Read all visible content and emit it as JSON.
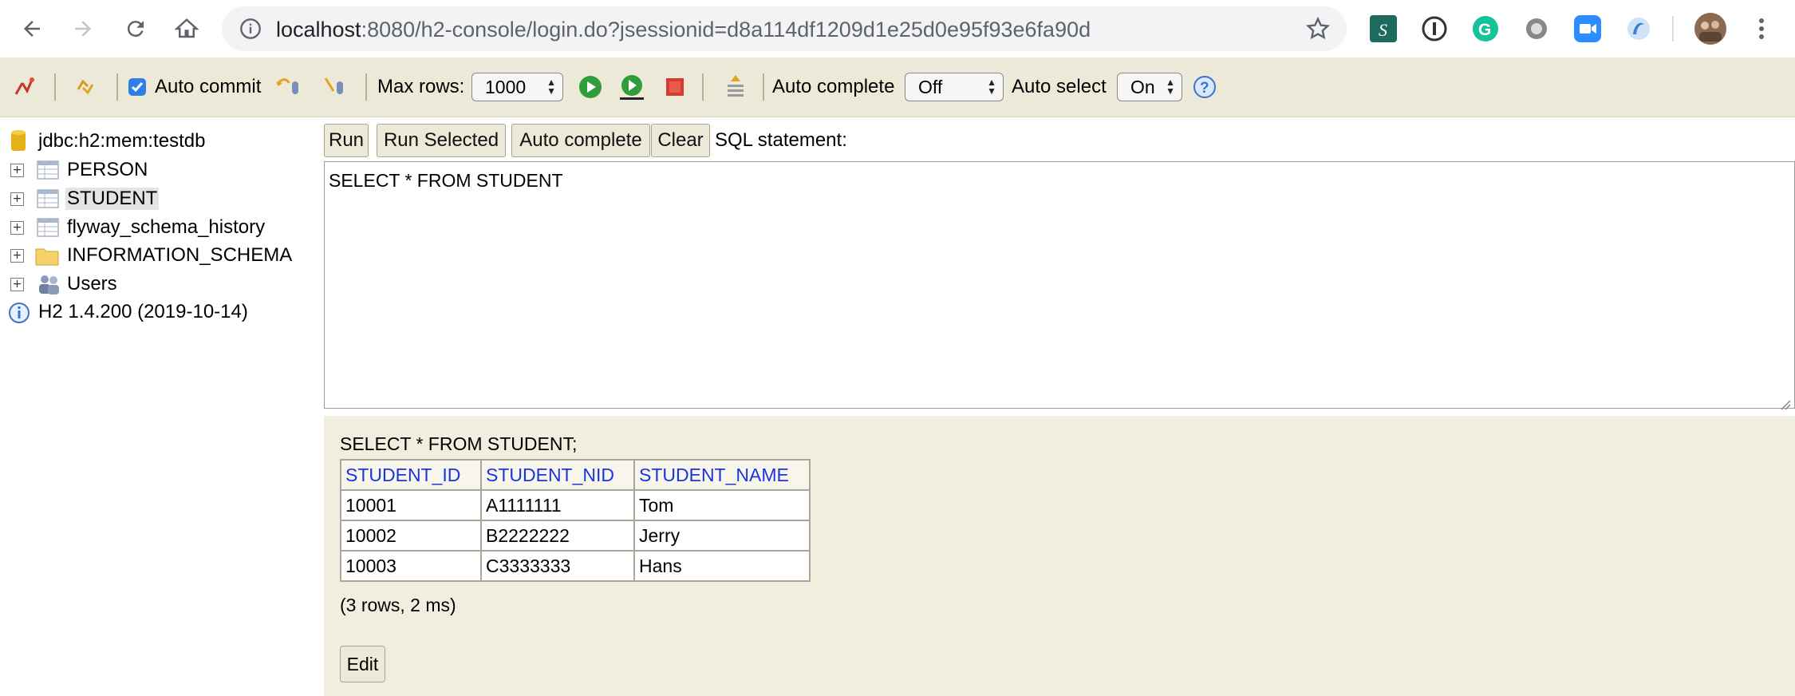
{
  "browser": {
    "url_host": "localhost",
    "url_rest": ":8080/h2-console/login.do?jsessionid=d8a114df1209d1e25d0e95f93e6fa90d"
  },
  "toolbar": {
    "auto_commit_label": "Auto commit",
    "auto_commit_checked": true,
    "max_rows_label": "Max rows:",
    "max_rows_value": "1000",
    "auto_complete_label": "Auto complete",
    "auto_complete_value": "Off",
    "auto_select_label": "Auto select",
    "auto_select_value": "On"
  },
  "tree": {
    "connection": "jdbc:h2:mem:testdb",
    "items": [
      {
        "label": "PERSON",
        "type": "table"
      },
      {
        "label": "STUDENT",
        "type": "table",
        "selected": true
      },
      {
        "label": "flyway_schema_history",
        "type": "table"
      },
      {
        "label": "INFORMATION_SCHEMA",
        "type": "folder"
      },
      {
        "label": "Users",
        "type": "users"
      }
    ],
    "version": "H2 1.4.200 (2019-10-14)"
  },
  "sql": {
    "run_label": "Run",
    "run_selected_label": "Run Selected",
    "auto_complete_label": "Auto complete",
    "clear_label": "Clear",
    "statement_label": "SQL statement:",
    "statement_text": "SELECT * FROM STUDENT"
  },
  "results": {
    "statement": "SELECT * FROM STUDENT;",
    "columns": [
      "STUDENT_ID",
      "STUDENT_NID",
      "STUDENT_NAME"
    ],
    "rows": [
      [
        "10001",
        "A1111111",
        "Tom"
      ],
      [
        "10002",
        "B2222222",
        "Jerry"
      ],
      [
        "10003",
        "C3333333",
        "Hans"
      ]
    ],
    "row_count": "(3 rows, 2 ms)",
    "edit_label": "Edit"
  },
  "colors": {
    "toolbar_bg": "#ece9d8",
    "results_bg": "#f1eedf",
    "column_header_text": "#1a35e0"
  }
}
